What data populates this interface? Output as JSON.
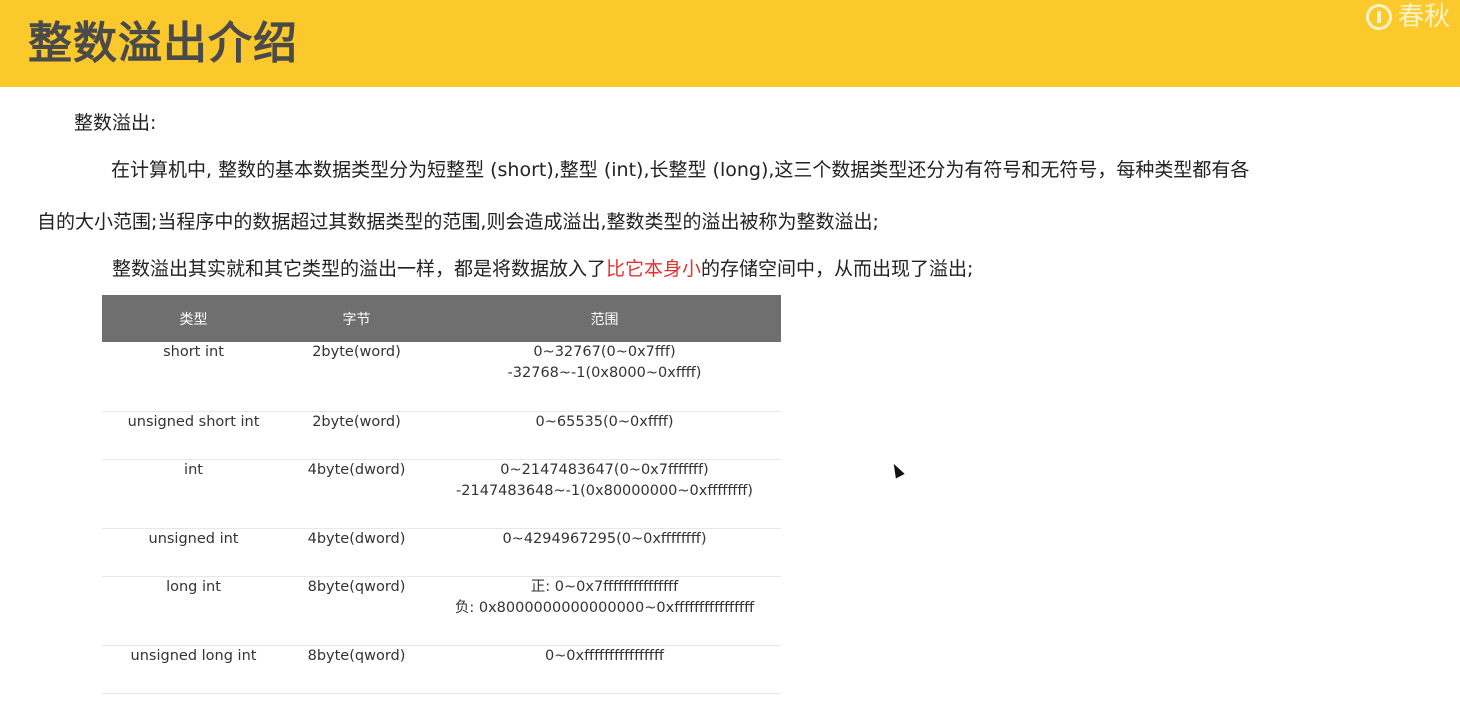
{
  "header": {
    "title": "整数溢出介绍",
    "logo_text": "春秋"
  },
  "paragraphs": {
    "heading": "整数溢出:",
    "p1_line1": "在计算机中, 整数的基本数据类型分为短整型 (short),整型 (int),长整型 (long),这三个数据类型还分为有符号和无符号，每种类型都有各",
    "p1_line2": "自的大小范围;当程序中的数据超过其数据类型的范围,则会造成溢出,整数类型的溢出被称为整数溢出;",
    "p2_before": "整数溢出其实就和其它类型的溢出一样，都是将数据放入了",
    "p2_highlight": "比它本身小",
    "p2_after": "的存储空间中，从而出现了溢出;"
  },
  "table": {
    "headers": [
      "类型",
      "字节",
      "范围"
    ],
    "rows": [
      {
        "type": "short int",
        "bytes": "2byte(word)",
        "range": [
          "0~32767(0~0x7fff)",
          "-32768~-1(0x8000~0xffff)"
        ]
      },
      {
        "type": "unsigned short int",
        "bytes": "2byte(word)",
        "range": [
          "0~65535(0~0xffff)"
        ]
      },
      {
        "type": "int",
        "bytes": "4byte(dword)",
        "range": [
          "0~2147483647(0~0x7fffffff)",
          "-2147483648~-1(0x80000000~0xffffffff)"
        ]
      },
      {
        "type": "unsigned int",
        "bytes": "4byte(dword)",
        "range": [
          "0~4294967295(0~0xffffffff)"
        ]
      },
      {
        "type": "long int",
        "bytes": "8byte(qword)",
        "range": [
          "正: 0~0x7fffffffffffffff",
          "负: 0x8000000000000000~0xffffffffffffffff"
        ]
      },
      {
        "type": "unsigned long int",
        "bytes": "8byte(qword)",
        "range": [
          "0~0xffffffffffffffff"
        ]
      }
    ]
  },
  "colors": {
    "header_bg": "#fbc92c",
    "highlight": "#e5322d",
    "table_header_bg": "#6f6f6f"
  }
}
